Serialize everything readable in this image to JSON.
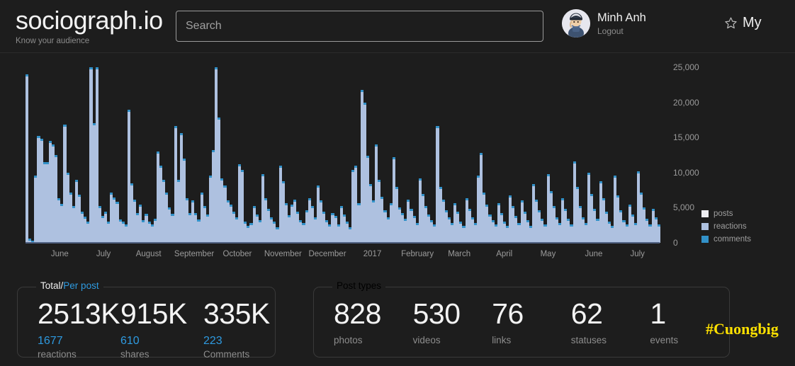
{
  "brand": {
    "title": "sociograph.io",
    "tagline": "Know your audience"
  },
  "search": {
    "placeholder": "Search",
    "value": ""
  },
  "user": {
    "name": "Minh Anh",
    "logout_label": "Logout",
    "avatar_icon": "user-avatar-cartoon"
  },
  "my": {
    "label": "My",
    "icon": "star-outline-icon"
  },
  "colors": {
    "background": "#1d1d1d",
    "accent_blue": "#2e9ae0",
    "posts": "#eeeef2",
    "reactions": "#aec1e0",
    "comments": "#3291c8",
    "watermark": "#ffe100"
  },
  "chart_data": {
    "type": "bar",
    "title": "",
    "xlabel": "",
    "ylabel": "",
    "ylim": [
      0,
      25000
    ],
    "yticks": [
      25000,
      20000,
      15000,
      10000,
      5000,
      0
    ],
    "ytick_labels": [
      "25,000",
      "20,000",
      "15,000",
      "10,000",
      "5,000",
      "0"
    ],
    "grid": false,
    "legend_position": "right",
    "legend": [
      {
        "label": "posts",
        "color": "#eeeef2"
      },
      {
        "label": "reactions",
        "color": "#aec1e0"
      },
      {
        "label": "comments",
        "color": "#3291c8"
      }
    ],
    "categories": [
      "June",
      "July",
      "August",
      "September",
      "October",
      "November",
      "December",
      "2017",
      "February",
      "March",
      "April",
      "May",
      "June",
      "July"
    ],
    "tick_positions_pct": [
      5.4,
      12.3,
      19.4,
      26.6,
      33.4,
      40.6,
      47.6,
      54.7,
      61.8,
      68.4,
      75.5,
      82.4,
      89.6,
      96.5
    ],
    "series": [
      {
        "name": "reactions",
        "values": [
          24000,
          600,
          300,
          9600,
          15200,
          14800,
          11500,
          11500,
          14500,
          14000,
          12500,
          6400,
          5500,
          16800,
          10000,
          7200,
          5200,
          9000,
          6900,
          4400,
          3700,
          3000,
          25000,
          17000,
          25000,
          5200,
          3800,
          4400,
          3000,
          7200,
          6500,
          5800,
          3300,
          3000,
          2600,
          19000,
          8500,
          6200,
          4200,
          5400,
          3200,
          4100,
          3000,
          2600,
          3400,
          13000,
          11000,
          9000,
          7200,
          5000,
          4100,
          16600,
          9000,
          15600,
          12000,
          6400,
          4200,
          6000,
          4200,
          3300,
          7200,
          5200,
          4000,
          9600,
          13200,
          25000,
          17800,
          9200,
          8200,
          6000,
          5400,
          4400,
          3600,
          11200,
          10400,
          3000,
          2400,
          2800,
          5200,
          4000,
          3200,
          9800,
          6400,
          4800,
          3600,
          3000,
          2200,
          11000,
          8800,
          5600,
          3900,
          5400,
          6200,
          4400,
          3200,
          2800,
          4600,
          6400,
          5200,
          3600,
          8200,
          6000,
          4400,
          3200,
          2600,
          4200,
          3800,
          2600,
          5200,
          4000,
          3000,
          2200,
          10400,
          11000,
          5600,
          21800,
          20000,
          12400,
          8400,
          6000,
          14000,
          9000,
          6600,
          4600,
          3600,
          5600,
          12200,
          8000,
          5000,
          4200,
          3400,
          6200,
          4800,
          3800,
          2800,
          9200,
          7000,
          5200,
          4000,
          3200,
          2600,
          16600,
          8000,
          6200,
          4600,
          3600,
          2800,
          5600,
          4400,
          3000,
          2400,
          6400,
          4800,
          3600,
          2800,
          9600,
          12800,
          7200,
          5400,
          4000,
          3200,
          2600,
          5600,
          4200,
          3000,
          2400,
          6800,
          5200,
          3800,
          2800,
          6000,
          4400,
          3200,
          2400,
          8400,
          6200,
          4600,
          3400,
          2600,
          9800,
          7400,
          5200,
          3600,
          2800,
          6400,
          4800,
          3400,
          2600,
          11600,
          8000,
          5200,
          3600,
          2800,
          10000,
          7000,
          4800,
          3400,
          8800,
          6400,
          4400,
          3000,
          2400,
          9600,
          6800,
          4600,
          3200,
          2600,
          5400,
          4000,
          2800,
          10200,
          7200,
          5000,
          3400,
          2600,
          4800,
          3600,
          2600
        ]
      }
    ]
  },
  "panel_total": {
    "legend_primary": "Total",
    "legend_separator": "/",
    "legend_secondary": "Per post",
    "stats": [
      {
        "total": "2513K",
        "per_post": "1677",
        "label": "reactions"
      },
      {
        "total": "915K",
        "per_post": "610",
        "label": "shares"
      },
      {
        "total": "335K",
        "per_post": "223",
        "label": "Comments"
      }
    ]
  },
  "panel_types": {
    "legend": "Post types",
    "stats": [
      {
        "value": "828",
        "label": "photos"
      },
      {
        "value": "530",
        "label": "videos"
      },
      {
        "value": "76",
        "label": "links"
      },
      {
        "value": "62",
        "label": "statuses"
      },
      {
        "value": "1",
        "label": "events"
      }
    ]
  },
  "watermark": {
    "text": "#Cuongbig"
  }
}
